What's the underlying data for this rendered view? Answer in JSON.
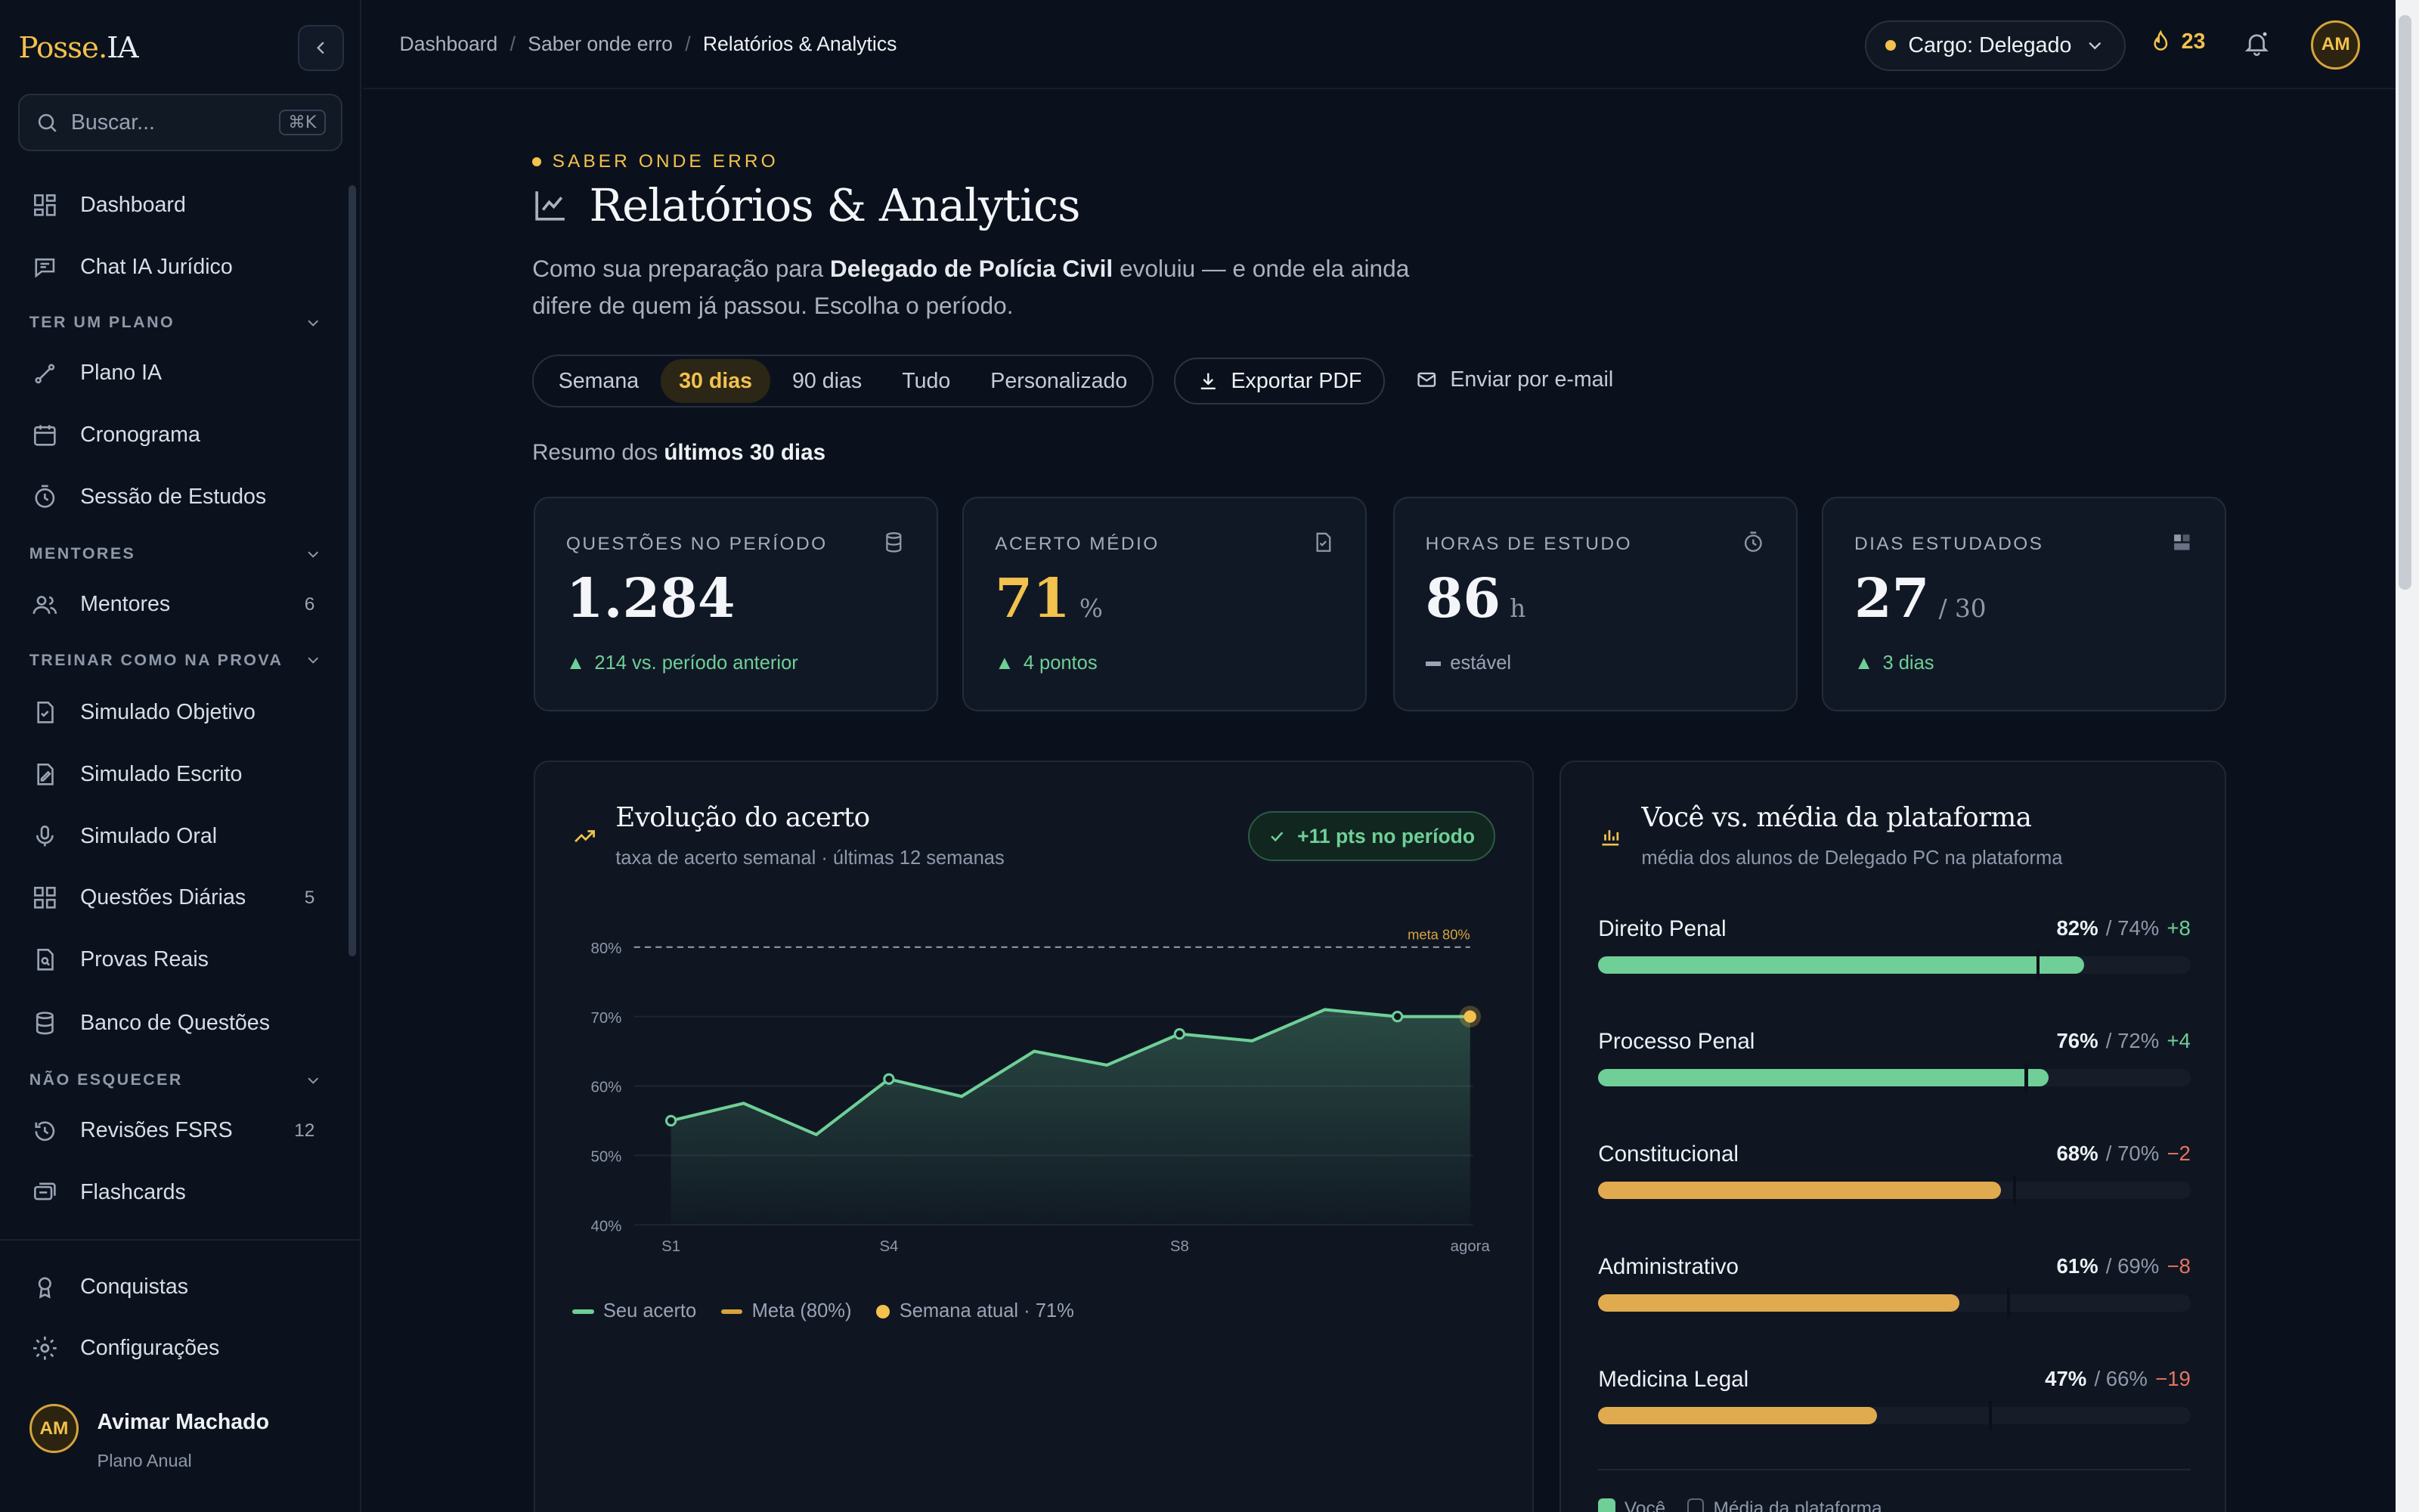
{
  "brand": {
    "part1": "Posse.",
    "part2": "IA"
  },
  "search": {
    "placeholder": "Buscar...",
    "shortcut": "⌘K"
  },
  "nav": {
    "dashboard": "Dashboard",
    "chat": "Chat IA Jurídico",
    "section_plano": "TER UM PLANO",
    "plano_ia": "Plano IA",
    "cronograma": "Cronograma",
    "sessao": "Sessão de Estudos",
    "section_mentores": "MENTORES",
    "mentores": "Mentores",
    "mentores_count": "6",
    "section_treinar": "TREINAR COMO NA PROVA",
    "sim_objetivo": "Simulado Objetivo",
    "sim_escrito": "Simulado Escrito",
    "sim_oral": "Simulado Oral",
    "questoes_diarias": "Questões Diárias",
    "questoes_count": "5",
    "provas_reais": "Provas Reais",
    "banco": "Banco de Questões",
    "section_esquecer": "NÃO ESQUECER",
    "revisoes": "Revisões FSRS",
    "revisoes_count": "12",
    "flashcards": "Flashcards",
    "conquistas": "Conquistas",
    "config": "Configurações"
  },
  "user": {
    "initials": "AM",
    "name": "Avimar Machado",
    "plan": "Plano Anual"
  },
  "breadcrumb": [
    "Dashboard",
    "Saber onde erro",
    "Relatórios & Analytics"
  ],
  "topbar": {
    "cargo": "Cargo: Delegado",
    "streak": "23"
  },
  "header": {
    "eyebrow": "SABER ONDE ERRO",
    "title": "Relatórios & Analytics",
    "lead_pre": "Como sua preparação para ",
    "lead_bold": "Delegado de Polícia Civil",
    "lead_post": " evoluiu — e onde ela ainda difere de quem já passou. Escolha o período."
  },
  "periods": [
    "Semana",
    "30 dias",
    "90 dias",
    "Tudo",
    "Personalizado"
  ],
  "active_period": "30 dias",
  "actions": {
    "pdf": "Exportar PDF",
    "email": "Enviar por e-mail"
  },
  "summary": {
    "pre": "Resumo dos ",
    "bold": "últimos 30 dias"
  },
  "cards": [
    {
      "label": "QUESTÕES NO PERÍODO",
      "value": "1.284",
      "unit": "",
      "delta": "214 vs. período anterior"
    },
    {
      "label": "ACERTO MÉDIO",
      "value": "71",
      "unit": "%",
      "delta": "4 pontos"
    },
    {
      "label": "HORAS DE ESTUDO",
      "value": "86",
      "unit": "h",
      "delta": "estável"
    },
    {
      "label": "DIAS ESTUDADOS",
      "value": "27",
      "unit": "/ 30",
      "delta": "3 dias"
    }
  ],
  "evolution": {
    "title": "Evolução do acerto",
    "subtitle": "taxa de acerto semanal · últimas 12 semanas",
    "badge": "+11 pts no período",
    "legend_you": "Seu acerto",
    "legend_goal": "Meta (80%)",
    "legend_current": "Semana atual · 71%"
  },
  "chart_data": {
    "type": "area",
    "x": [
      "S1",
      "S2",
      "S3",
      "S4",
      "S5",
      "S6",
      "S7",
      "S8",
      "S9",
      "S10",
      "S11",
      "agora"
    ],
    "x_tick_labels": [
      "S1",
      "S4",
      "S8",
      "agora"
    ],
    "series": [
      {
        "name": "Seu acerto",
        "values": [
          55,
          57.5,
          53,
          61,
          58.5,
          65,
          63,
          67.5,
          66.5,
          71,
          70,
          70
        ]
      }
    ],
    "goal": {
      "label": "meta 80%",
      "value": 80
    },
    "y_ticks": [
      "40%",
      "50%",
      "60%",
      "70%",
      "80%"
    ],
    "ylim": [
      40,
      80
    ],
    "colors": {
      "line": "#6fcf97",
      "goal": "#d5a43b",
      "current": "#f2c14e"
    }
  },
  "comparison": {
    "title": "Você vs. média da plataforma",
    "subtitle": "média dos alunos de Delegado PC na plataforma",
    "rows": [
      {
        "name": "Direito Penal",
        "you": "82%",
        "avg": "/ 74%",
        "diff": "+8",
        "you_v": 82,
        "avg_v": 74,
        "positive": true
      },
      {
        "name": "Processo Penal",
        "you": "76%",
        "avg": "/ 72%",
        "diff": "+4",
        "you_v": 76,
        "avg_v": 72,
        "positive": true
      },
      {
        "name": "Constitucional",
        "you": "68%",
        "avg": "/ 70%",
        "diff": "−2",
        "you_v": 68,
        "avg_v": 70,
        "positive": false
      },
      {
        "name": "Administrativo",
        "you": "61%",
        "avg": "/ 69%",
        "diff": "−8",
        "you_v": 61,
        "avg_v": 69,
        "positive": false
      },
      {
        "name": "Medicina Legal",
        "you": "47%",
        "avg": "/ 66%",
        "diff": "−19",
        "you_v": 47,
        "avg_v": 66,
        "positive": false
      }
    ],
    "legend_you": "Você",
    "legend_avg": "Média da plataforma"
  },
  "colors": {
    "accent": "#f2c14e",
    "positive": "#6fcf97",
    "negative": "#e5745e"
  }
}
